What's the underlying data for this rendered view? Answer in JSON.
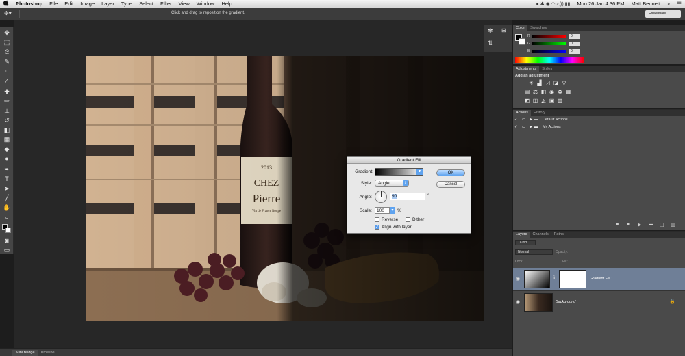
{
  "menubar": {
    "apple": "",
    "app": "Photoshop",
    "items": [
      "File",
      "Edit",
      "Image",
      "Layer",
      "Type",
      "Select",
      "Filter",
      "View",
      "Window",
      "Help"
    ],
    "clock": "Mon 26 Jan  4:36 PM",
    "user": "Matt Bennett"
  },
  "options": {
    "hint": "Click and drag to reposition the gradient.",
    "workspace": "Essentials"
  },
  "bottom": {
    "tabs": [
      "Mini Bridge",
      "Timeline"
    ]
  },
  "color_panel": {
    "tabs": [
      "Color",
      "Swatches"
    ],
    "channels": [
      {
        "label": "R",
        "value": "0"
      },
      {
        "label": "G",
        "value": "0"
      },
      {
        "label": "B",
        "value": "0"
      }
    ]
  },
  "adjustments_panel": {
    "tabs": [
      "Adjustments",
      "Styles"
    ],
    "heading": "Add an adjustment"
  },
  "actions_panel": {
    "tabs": [
      "Actions",
      "History"
    ],
    "rows": [
      "Default Actions",
      "My Actions"
    ]
  },
  "layers_panel": {
    "tabs": [
      "Layers",
      "Channels",
      "Paths"
    ],
    "kind": "Kind",
    "blend": "Normal",
    "opacity_label": "Opacity:",
    "lock_label": "Lock:",
    "fill_label": "Fill:",
    "layers": [
      {
        "name": "Gradient Fill 1"
      },
      {
        "name": "Background"
      }
    ]
  },
  "dialog": {
    "title": "Gradient Fill",
    "gradient_label": "Gradient:",
    "style_label": "Style:",
    "style_value": "Angle",
    "angle_label": "Angle:",
    "angle_value": "90",
    "angle_unit": "°",
    "scale_label": "Scale:",
    "scale_value": "100",
    "scale_unit": "%",
    "reverse": "Reverse",
    "dither": "Dither",
    "align": "Align with layer",
    "ok": "OK",
    "cancel": "Cancel"
  }
}
